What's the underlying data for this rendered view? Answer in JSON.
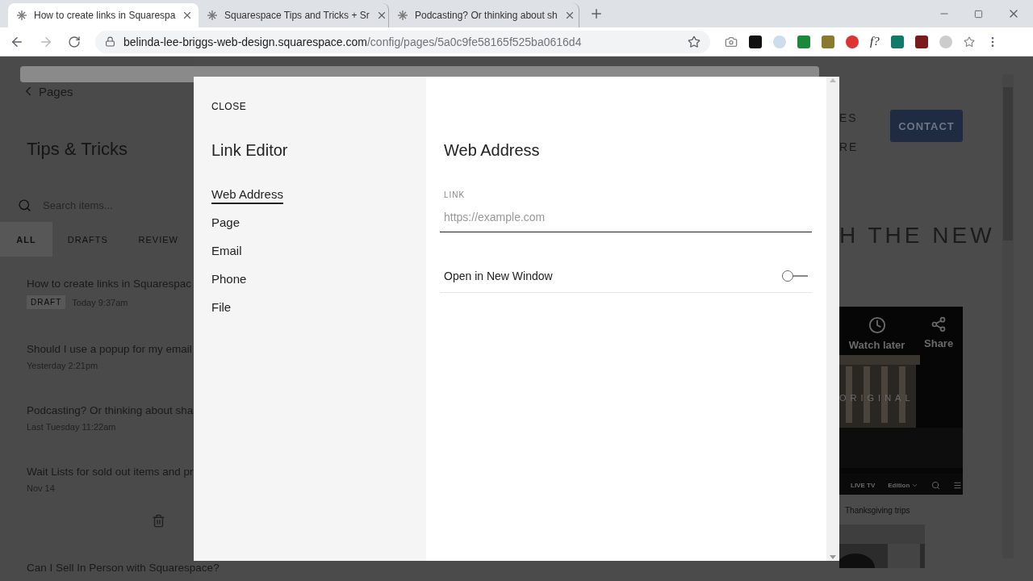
{
  "browser": {
    "tabs": [
      {
        "title": "How to create links in Squarespa",
        "selected": true
      },
      {
        "title": "Squarespace Tips and Tricks + Sr",
        "selected": false
      },
      {
        "title": "Podcasting? Or thinking about sh",
        "selected": false
      }
    ],
    "url": {
      "domain": "belinda-lee-briggs-web-design.squarespace.com",
      "path": "/config/pages/5a0c9fe58165f525ba0616d4"
    },
    "extension_label": "f?"
  },
  "sidebar": {
    "back_label": "Pages",
    "title": "Tips & Tricks",
    "search": {
      "placeholder": "Search items..."
    },
    "filters": [
      {
        "label": "ALL",
        "selected": true
      },
      {
        "label": "DRAFTS",
        "selected": false
      },
      {
        "label": "REVIEW",
        "selected": false
      }
    ],
    "posts": [
      {
        "title": "How to create links in Squarespac",
        "badge": "DRAFT",
        "date": "Today 9:37am"
      },
      {
        "title": "Should I use a popup for my email",
        "date": "Yesterday 2:21pm"
      },
      {
        "title": "Podcasting? Or thinking about sha",
        "date": "Last Tuesday 11:22am"
      },
      {
        "title": "Wait Lists for sold out items and pr",
        "date": "Nov 14"
      },
      {
        "title": "Can I Sell In Person with Squarespace?"
      }
    ]
  },
  "preview": {
    "nav": [
      "ES",
      "RE"
    ],
    "button": "CONTACT",
    "headline": "H THE NEW",
    "video": {
      "actions": [
        "Watch later",
        "Share"
      ],
      "overlay": "ORIGINAL",
      "menu": [
        "LIVE TV",
        "Edition"
      ]
    },
    "caption": "Thanksgiving trips"
  },
  "modal": {
    "close": "CLOSE",
    "title": "Link Editor",
    "menu": [
      {
        "label": "Web Address",
        "selected": true
      },
      {
        "label": "Page",
        "selected": false
      },
      {
        "label": "Email",
        "selected": false
      },
      {
        "label": "Phone",
        "selected": false
      },
      {
        "label": "File",
        "selected": false
      }
    ],
    "heading": "Web Address",
    "field": {
      "label": "LINK",
      "placeholder": "https://example.com"
    },
    "toggle": {
      "label": "Open in New Window",
      "on": false
    }
  }
}
